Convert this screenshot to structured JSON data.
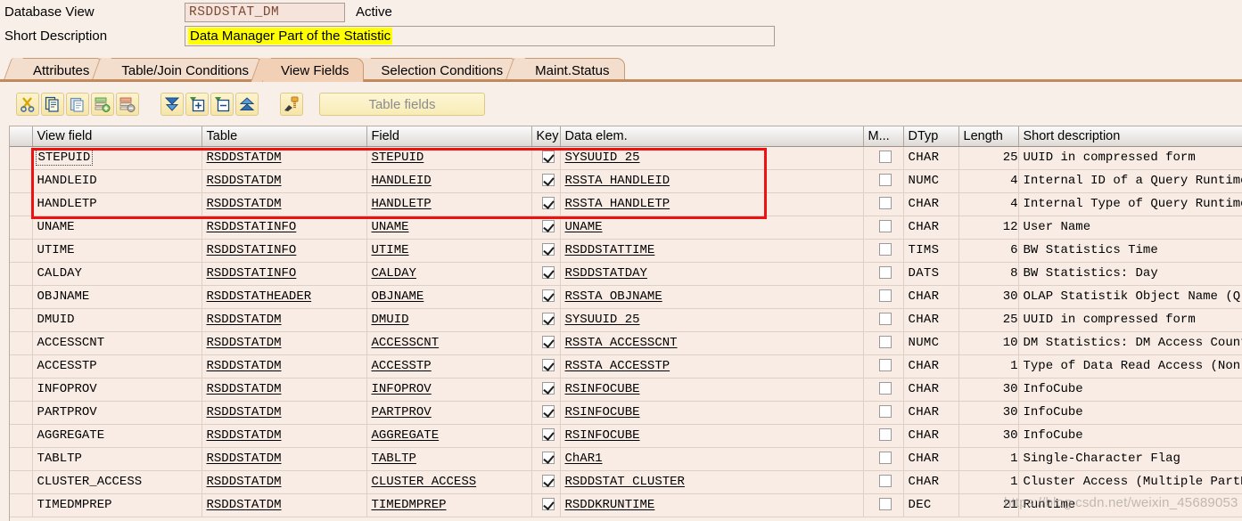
{
  "header": {
    "view_type_label": "Database View",
    "view_name": "RSDDSTAT_DM",
    "status": "Active",
    "short_description_label": "Short Description",
    "short_description_value": "Data Manager Part of the Statistic",
    "highlight_color": "#ffff00",
    "input_text_color": "#7a4a32"
  },
  "tabs": [
    {
      "label": "Attributes",
      "active": false
    },
    {
      "label": "Table/Join Conditions",
      "active": false
    },
    {
      "label": "View Fields",
      "active": true
    },
    {
      "label": "Selection Conditions",
      "active": false
    },
    {
      "label": "Maint.Status",
      "active": false
    }
  ],
  "toolbar": {
    "buttons": [
      {
        "icon": "cut-scissors-icon",
        "title": "Cut"
      },
      {
        "icon": "copy-icon",
        "title": "Copy"
      },
      {
        "icon": "paste-icon",
        "title": "Paste"
      },
      {
        "icon": "insert-row-icon",
        "title": "Insert Row"
      },
      {
        "icon": "delete-row-icon",
        "title": "Delete Row"
      },
      {
        "icon": "sort-descending-icon",
        "title": "Sort Descending"
      },
      {
        "icon": "expand-plus-icon",
        "title": "Expand"
      },
      {
        "icon": "collapse-minus-icon",
        "title": "Collapse"
      },
      {
        "icon": "sort-ascending-icon",
        "title": "Sort Ascending"
      },
      {
        "icon": "key-append-icon",
        "title": "Append Key"
      }
    ],
    "table_fields_label": "Table fields",
    "table_fields_enabled": false
  },
  "grid": {
    "columns": [
      "View field",
      "Table",
      "Field",
      "Key",
      "Data elem.",
      "M...",
      "DTyp",
      "Length",
      "Short description"
    ],
    "rows": [
      {
        "view_field": "STEPUID",
        "table": "RSDDSTATDM",
        "field": "STEPUID",
        "key": true,
        "data_elem": "SYSUUID 25",
        "m": false,
        "dtyp": "CHAR",
        "length": "25",
        "short_description": "UUID in compressed form",
        "focused": true,
        "highlighted": true
      },
      {
        "view_field": "HANDLEID",
        "table": "RSDDSTATDM",
        "field": "HANDLEID",
        "key": true,
        "data_elem": "RSSTA HANDLEID",
        "m": false,
        "dtyp": "NUMC",
        "length": "4",
        "short_description": "Internal ID of a Query Runtime",
        "focused": false,
        "highlighted": true
      },
      {
        "view_field": "HANDLETP",
        "table": "RSDDSTATDM",
        "field": "HANDLETP",
        "key": true,
        "data_elem": "RSSTA HANDLETP",
        "m": false,
        "dtyp": "CHAR",
        "length": "4",
        "short_description": "Internal Type of Query Runtime",
        "focused": false,
        "highlighted": true
      },
      {
        "view_field": "UNAME",
        "table": "RSDDSTATINFO",
        "field": "UNAME",
        "key": true,
        "data_elem": "UNAME",
        "m": false,
        "dtyp": "CHAR",
        "length": "12",
        "short_description": "User Name",
        "focused": false,
        "highlighted": false
      },
      {
        "view_field": "UTIME",
        "table": "RSDDSTATINFO",
        "field": "UTIME",
        "key": true,
        "data_elem": "RSDDSTATTIME",
        "m": false,
        "dtyp": "TIMS",
        "length": "6",
        "short_description": "BW Statistics Time",
        "focused": false,
        "highlighted": false
      },
      {
        "view_field": "CALDAY",
        "table": "RSDDSTATINFO",
        "field": "CALDAY",
        "key": true,
        "data_elem": "RSDDSTATDAY",
        "m": false,
        "dtyp": "DATS",
        "length": "8",
        "short_description": "BW Statistics: Day",
        "focused": false,
        "highlighted": false
      },
      {
        "view_field": "OBJNAME",
        "table": "RSDDSTATHEADER",
        "field": "OBJNAME",
        "key": true,
        "data_elem": "RSSTA OBJNAME",
        "m": false,
        "dtyp": "CHAR",
        "length": "30",
        "short_description": "OLAP Statistik Object Name  (Q",
        "focused": false,
        "highlighted": false
      },
      {
        "view_field": "DMUID",
        "table": "RSDDSTATDM",
        "field": "DMUID",
        "key": true,
        "data_elem": "SYSUUID 25",
        "m": false,
        "dtyp": "CHAR",
        "length": "25",
        "short_description": "UUID in compressed form",
        "focused": false,
        "highlighted": false
      },
      {
        "view_field": "ACCESSCNT",
        "table": "RSDDSTATDM",
        "field": "ACCESSCNT",
        "key": true,
        "data_elem": "RSSTA ACCESSCNT",
        "m": false,
        "dtyp": "NUMC",
        "length": "10",
        "short_description": "DM Statistics: DM Access Count",
        "focused": false,
        "highlighted": false
      },
      {
        "view_field": "ACCESSTP",
        "table": "RSDDSTATDM",
        "field": "ACCESSTP",
        "key": true,
        "data_elem": "RSSTA ACCESSTP",
        "m": false,
        "dtyp": "CHAR",
        "length": "1",
        "short_description": "Type of Data Read Access (Non",
        "focused": false,
        "highlighted": false
      },
      {
        "view_field": "INFOPROV",
        "table": "RSDDSTATDM",
        "field": "INFOPROV",
        "key": true,
        "data_elem": "RSINFOCUBE",
        "m": false,
        "dtyp": "CHAR",
        "length": "30",
        "short_description": "InfoCube",
        "focused": false,
        "highlighted": false
      },
      {
        "view_field": "PARTPROV",
        "table": "RSDDSTATDM",
        "field": "PARTPROV",
        "key": true,
        "data_elem": "RSINFOCUBE",
        "m": false,
        "dtyp": "CHAR",
        "length": "30",
        "short_description": "InfoCube",
        "focused": false,
        "highlighted": false
      },
      {
        "view_field": "AGGREGATE",
        "table": "RSDDSTATDM",
        "field": "AGGREGATE",
        "key": true,
        "data_elem": "RSINFOCUBE",
        "m": false,
        "dtyp": "CHAR",
        "length": "30",
        "short_description": "InfoCube",
        "focused": false,
        "highlighted": false
      },
      {
        "view_field": "TABLTP",
        "table": "RSDDSTATDM",
        "field": "TABLTP",
        "key": true,
        "data_elem": "ChAR1",
        "m": false,
        "dtyp": "CHAR",
        "length": "1",
        "short_description": "Single-Character Flag",
        "focused": false,
        "highlighted": false
      },
      {
        "view_field": "CLUSTER_ACCESS",
        "table": "RSDDSTATDM",
        "field": "CLUSTER ACCESS",
        "key": true,
        "data_elem": "RSDDSTAT CLUSTER",
        "m": false,
        "dtyp": "CHAR",
        "length": "1",
        "short_description": "Cluster Access (Multiple PartPro",
        "focused": false,
        "highlighted": false
      },
      {
        "view_field": "TIMEDMPREP",
        "table": "RSDDSTATDM",
        "field": "TIMEDMPREP",
        "key": true,
        "data_elem": "RSDDKRUNTIME",
        "m": false,
        "dtyp": "DEC",
        "length": "21",
        "short_description": "Runtime",
        "focused": false,
        "highlighted": false
      }
    ]
  },
  "annotations": {
    "highlight_box_color": "#ee1111"
  },
  "watermark": {
    "text": "https://blog.csdn.net/weixin_45689053"
  }
}
